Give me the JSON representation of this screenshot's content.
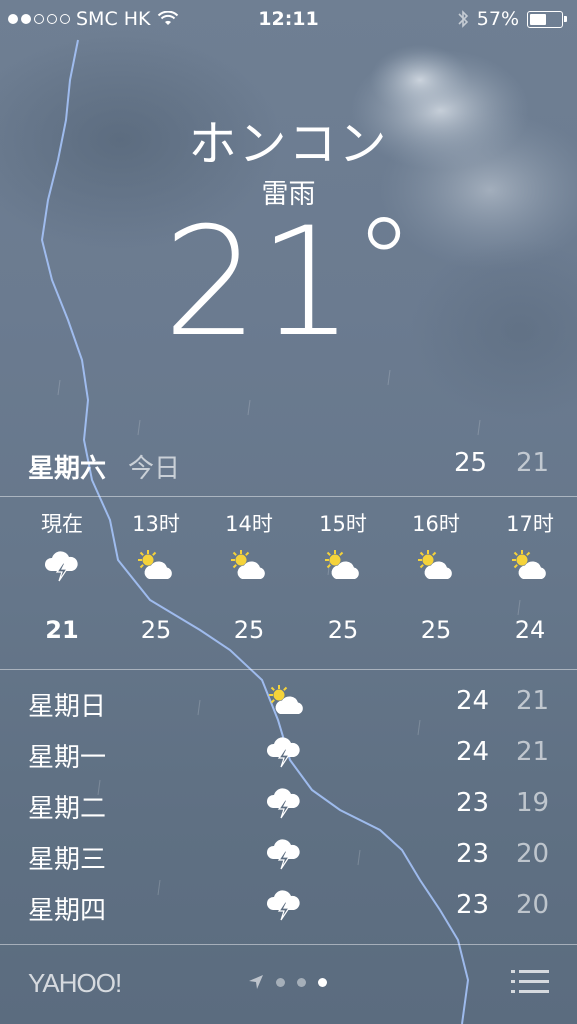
{
  "status_bar": {
    "carrier": "SMC HK",
    "time": "12:11",
    "battery_percent": "57%",
    "battery_level": 0.57,
    "signal_bars_filled": 2,
    "signal_bars_total": 5,
    "icons": [
      "wifi-icon",
      "bluetooth-icon",
      "battery-icon"
    ]
  },
  "location": {
    "city": "ホンコン",
    "condition": "雷雨",
    "temperature": "21",
    "degree_symbol": "°"
  },
  "today": {
    "day": "星期六",
    "label": "今日",
    "high": "25",
    "low": "21"
  },
  "hourly": [
    {
      "time": "現在",
      "icon": "thunderstorm-icon",
      "temp": "21"
    },
    {
      "time": "13时",
      "icon": "partly-sunny-icon",
      "temp": "25"
    },
    {
      "time": "14时",
      "icon": "partly-sunny-icon",
      "temp": "25"
    },
    {
      "time": "15时",
      "icon": "partly-sunny-icon",
      "temp": "25"
    },
    {
      "time": "16时",
      "icon": "partly-sunny-icon",
      "temp": "25"
    },
    {
      "time": "17时",
      "icon": "partly-sunny-icon",
      "temp": "24"
    }
  ],
  "daily": [
    {
      "day": "星期日",
      "icon": "partly-sunny-icon",
      "high": "24",
      "low": "21"
    },
    {
      "day": "星期一",
      "icon": "thunderstorm-icon",
      "high": "24",
      "low": "21"
    },
    {
      "day": "星期二",
      "icon": "thunderstorm-icon",
      "high": "23",
      "low": "19"
    },
    {
      "day": "星期三",
      "icon": "thunderstorm-icon",
      "high": "23",
      "low": "20"
    },
    {
      "day": "星期四",
      "icon": "thunderstorm-icon",
      "high": "23",
      "low": "20"
    }
  ],
  "footer": {
    "brand": "YAHOO!",
    "pages_total": 3,
    "active_page": 3
  },
  "colors": {
    "sun": "#f5d33a",
    "cloud": "#ffffff",
    "lightning": "#9fc3ff"
  }
}
